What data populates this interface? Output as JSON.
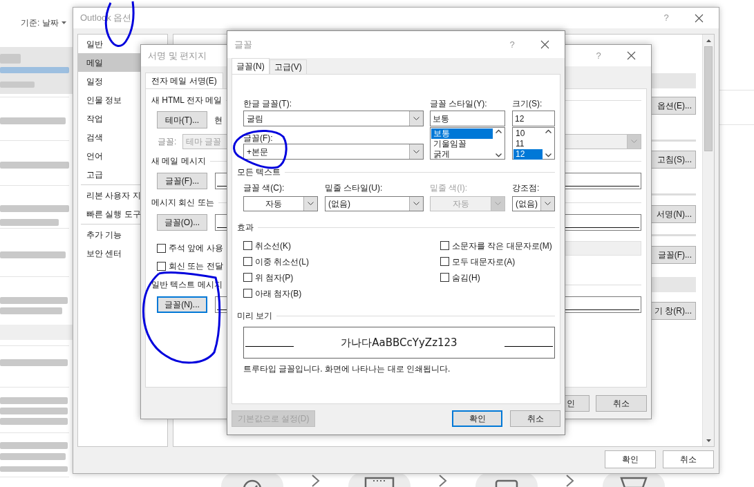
{
  "mail_list": {
    "sort_label": "기준: 날짜"
  },
  "options_window": {
    "title": "Outlook 옵션",
    "help": "?",
    "nav_groups": [
      {
        "items": [
          {
            "label": "일반",
            "selected": false
          },
          {
            "label": "메일",
            "selected": true
          },
          {
            "label": "일정",
            "selected": false
          },
          {
            "label": "인물 정보",
            "selected": false
          },
          {
            "label": "작업",
            "selected": false
          },
          {
            "label": "검색",
            "selected": false
          },
          {
            "label": "언어",
            "selected": false
          },
          {
            "label": "고급",
            "selected": false
          }
        ]
      },
      {
        "items": [
          {
            "label": "리본 사용자 지",
            "selected": false
          },
          {
            "label": "빠른 실행 도구",
            "selected": false
          }
        ]
      },
      {
        "items": [
          {
            "label": "추가 기능",
            "selected": false
          },
          {
            "label": "보안 센터",
            "selected": false
          }
        ]
      }
    ],
    "side_buttons": [
      "옵션(E)...",
      "고침(S)...",
      "서명(N)...",
      "글꼴(F)...",
      "기 창(R)..."
    ],
    "buttons": [
      "확인",
      "취소"
    ]
  },
  "signature_dialog": {
    "title": "서명 및 편지지",
    "help": "?",
    "tabs": [
      {
        "label": "전자 메일 서명(E)",
        "selected": true
      }
    ],
    "html_section": {
      "heading": "새 HTML 전자 메일",
      "theme_button": "테마(T)...",
      "current_text": "현",
      "font_label": "글꼴:",
      "font_value": "테마 글꼴"
    },
    "new_mail": {
      "heading": "새 메일 메시지",
      "button": {
        "label": "글꼴(F)...",
        "focused": false
      }
    },
    "reply": {
      "heading": "메시지 회신 또는",
      "button": {
        "label": "글꼴(O)...",
        "focused": false
      },
      "checkboxes": [
        {
          "label": "주석 앞에 사용",
          "checked": false
        },
        {
          "label": "회신 또는 전달",
          "checked": false
        }
      ]
    },
    "plain_text": {
      "heading": "일반 텍스트 메시지",
      "button": {
        "label": "글꼴(N)...",
        "focused": true
      }
    },
    "buttons": [
      "인",
      "취소"
    ]
  },
  "font_dialog": {
    "title": "글꼴",
    "help": "?",
    "tabs": [
      {
        "label": "글꼴(N)",
        "selected": true
      },
      {
        "label": "고급(V)",
        "selected": false
      }
    ],
    "korean_font": {
      "label": "한글 글꼴(T):",
      "value": "굴림"
    },
    "font": {
      "label": "글꼴(F):",
      "value": "+본문"
    },
    "font_style": {
      "label": "글꼴 스타일(Y):",
      "value": "보통",
      "options": [
        {
          "label": "보통",
          "selected": true
        },
        {
          "label": "기울임꼴",
          "selected": false
        },
        {
          "label": "굵게",
          "selected": false
        }
      ]
    },
    "size": {
      "label": "크기(S):",
      "value": "12",
      "options": [
        {
          "label": "10",
          "selected": false
        },
        {
          "label": "11",
          "selected": false
        },
        {
          "label": "12",
          "selected": true
        }
      ]
    },
    "all_text": {
      "heading": "모든 텍스트",
      "fields": [
        {
          "label": "글꼴 색(C):",
          "value": "자동",
          "disabled": false
        },
        {
          "label": "밑줄 스타일(U):",
          "value": "(없음)",
          "disabled": false
        },
        {
          "label": "밑줄 색(I):",
          "value": "자동",
          "disabled": true
        },
        {
          "label": "강조점:",
          "value": "(없음)",
          "disabled": false
        }
      ]
    },
    "effects": {
      "heading": "효과",
      "options": [
        {
          "label": "취소선(K)",
          "checked": false
        },
        {
          "label": "이중 취소선(L)",
          "checked": false
        },
        {
          "label": "위 첨자(P)",
          "checked": false
        },
        {
          "label": "아래 첨자(B)",
          "checked": false
        },
        {
          "label": "소문자를 작은 대문자로(M)",
          "checked": false
        },
        {
          "label": "모두 대문자로(A)",
          "checked": false
        },
        {
          "label": "숨김(H)",
          "checked": false
        }
      ]
    },
    "preview": {
      "heading": "미리 보기",
      "sample": "가나다AaBBCcYyZz123",
      "note": "트루타입 글꼴입니다. 화면에 나타나는 대로 인쇄됩니다."
    },
    "buttons": [
      {
        "label": "기본값으로 설정(D)",
        "disabled": true,
        "focused": false
      },
      {
        "label": "확인",
        "disabled": false,
        "focused": true
      },
      {
        "label": "취소",
        "disabled": false,
        "focused": false
      }
    ]
  }
}
